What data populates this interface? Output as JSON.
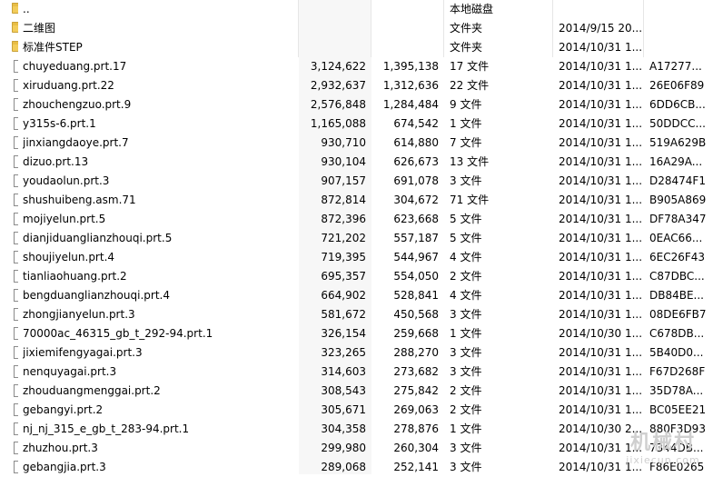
{
  "watermark": {
    "main": "机械村",
    "sub": "jixiecun.com"
  },
  "rows": [
    {
      "icon": "folder",
      "name": "..",
      "size": "",
      "packed": "",
      "type": "本地磁盘",
      "modified": "",
      "crc": ""
    },
    {
      "icon": "folder",
      "name": "二维图",
      "size": "",
      "packed": "",
      "type": "文件夹",
      "modified": "2014/9/15 20...",
      "crc": ""
    },
    {
      "icon": "folder",
      "name": "标准件STEP",
      "size": "",
      "packed": "",
      "type": "文件夹",
      "modified": "2014/10/31 1...",
      "crc": ""
    },
    {
      "icon": "file",
      "name": "chuyeduang.prt.17",
      "size": "3,124,622",
      "packed": "1,395,138",
      "type": "17 文件",
      "modified": "2014/10/31 1...",
      "crc": "A17277..."
    },
    {
      "icon": "file",
      "name": "xiruduang.prt.22",
      "size": "2,932,637",
      "packed": "1,312,636",
      "type": "22 文件",
      "modified": "2014/10/31 1...",
      "crc": "26E06F89"
    },
    {
      "icon": "file",
      "name": "zhouchengzuo.prt.9",
      "size": "2,576,848",
      "packed": "1,284,484",
      "type": "9 文件",
      "modified": "2014/10/31 1...",
      "crc": "6DD6CB..."
    },
    {
      "icon": "file",
      "name": "y315s-6.prt.1",
      "size": "1,165,088",
      "packed": "674,542",
      "type": "1 文件",
      "modified": "2014/10/31 1...",
      "crc": "50DDCC..."
    },
    {
      "icon": "file",
      "name": "jinxiangdaoye.prt.7",
      "size": "930,710",
      "packed": "614,880",
      "type": "7 文件",
      "modified": "2014/10/31 1...",
      "crc": "519A629B"
    },
    {
      "icon": "file",
      "name": "dizuo.prt.13",
      "size": "930,104",
      "packed": "626,673",
      "type": "13 文件",
      "modified": "2014/10/31 1...",
      "crc": "16A29A..."
    },
    {
      "icon": "file",
      "name": "youdaolun.prt.3",
      "size": "907,157",
      "packed": "691,078",
      "type": "3 文件",
      "modified": "2014/10/31 1...",
      "crc": "D28474F1"
    },
    {
      "icon": "file",
      "name": "shushuibeng.asm.71",
      "size": "872,814",
      "packed": "304,672",
      "type": "71 文件",
      "modified": "2014/10/31 1...",
      "crc": "B905A869"
    },
    {
      "icon": "file",
      "name": "mojiyelun.prt.5",
      "size": "872,396",
      "packed": "623,668",
      "type": "5 文件",
      "modified": "2014/10/31 1...",
      "crc": "DF78A347"
    },
    {
      "icon": "file",
      "name": "dianjiduanglianzhouqi.prt.5",
      "size": "721,202",
      "packed": "557,187",
      "type": "5 文件",
      "modified": "2014/10/31 1...",
      "crc": "0EAC66..."
    },
    {
      "icon": "file",
      "name": "shoujiyelun.prt.4",
      "size": "719,395",
      "packed": "544,967",
      "type": "4 文件",
      "modified": "2014/10/31 1...",
      "crc": "6EC26F43"
    },
    {
      "icon": "file",
      "name": "tianliaohuang.prt.2",
      "size": "695,357",
      "packed": "554,050",
      "type": "2 文件",
      "modified": "2014/10/31 1...",
      "crc": "C87DBC..."
    },
    {
      "icon": "file",
      "name": "bengduanglianzhouqi.prt.4",
      "size": "664,902",
      "packed": "528,841",
      "type": "4 文件",
      "modified": "2014/10/31 1...",
      "crc": "DB84BE..."
    },
    {
      "icon": "file",
      "name": "zhongjianyelun.prt.3",
      "size": "581,672",
      "packed": "450,568",
      "type": "3 文件",
      "modified": "2014/10/31 1...",
      "crc": "08DE6FB7"
    },
    {
      "icon": "file",
      "name": "70000ac_46315_gb_t_292-94.prt.1",
      "size": "326,154",
      "packed": "259,668",
      "type": "1 文件",
      "modified": "2014/10/30 1...",
      "crc": "C678DB..."
    },
    {
      "icon": "file",
      "name": "jixiemifengyagai.prt.3",
      "size": "323,265",
      "packed": "288,270",
      "type": "3 文件",
      "modified": "2014/10/31 1...",
      "crc": "5B40D0..."
    },
    {
      "icon": "file",
      "name": "nenquyagai.prt.3",
      "size": "314,603",
      "packed": "273,682",
      "type": "3 文件",
      "modified": "2014/10/31 1...",
      "crc": "F67D268F"
    },
    {
      "icon": "file",
      "name": "zhouduangmenggai.prt.2",
      "size": "308,543",
      "packed": "275,842",
      "type": "2 文件",
      "modified": "2014/10/31 1...",
      "crc": "35D78A..."
    },
    {
      "icon": "file",
      "name": "gebangyi.prt.2",
      "size": "305,671",
      "packed": "269,063",
      "type": "2 文件",
      "modified": "2014/10/31 1...",
      "crc": "BC05EE21"
    },
    {
      "icon": "file",
      "name": "nj_nj_315_e_gb_t_283-94.prt.1",
      "size": "304,358",
      "packed": "278,876",
      "type": "1 文件",
      "modified": "2014/10/30 2...",
      "crc": "880F3D93"
    },
    {
      "icon": "file",
      "name": "zhuzhou.prt.3",
      "size": "299,980",
      "packed": "260,304",
      "type": "3 文件",
      "modified": "2014/10/31 1...",
      "crc": "7344DB..."
    },
    {
      "icon": "file",
      "name": "gebangjia.prt.3",
      "size": "289,068",
      "packed": "252,141",
      "type": "3 文件",
      "modified": "2014/10/31 1...",
      "crc": "F86E0265"
    }
  ]
}
